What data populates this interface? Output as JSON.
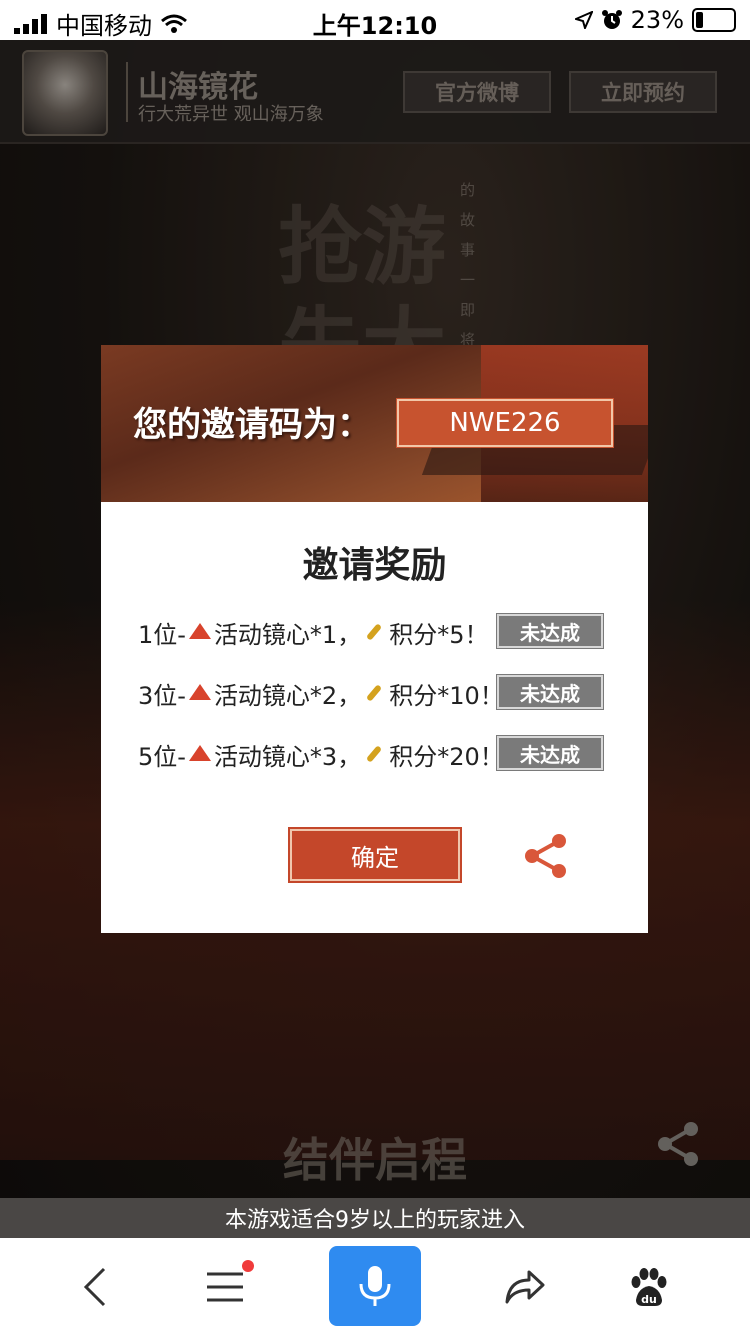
{
  "status_bar": {
    "carrier": "中国移动",
    "time": "上午12:10",
    "battery": "23%"
  },
  "header": {
    "title": "山海镜花",
    "subtitle": "行大荒异世 观山海万象",
    "weibo_button": "官方微博",
    "reserve_button": "立即预约"
  },
  "background": {
    "deco_text_1": "抢游",
    "deco_text_2": "先大",
    "vertical_text": "的故事一即将",
    "bottom_title": "结伴启程"
  },
  "modal": {
    "invite_label": "您的邀请码为：",
    "invite_code": "NWE226",
    "title": "邀请奖励",
    "rewards": [
      {
        "tier": "1位-",
        "item": "活动镜心*1，",
        "points": "积分*5！",
        "status": "未达成"
      },
      {
        "tier": "3位-",
        "item": "活动镜心*2，",
        "points": "积分*10！",
        "status": "未达成"
      },
      {
        "tier": "5位-",
        "item": "活动镜心*3，",
        "points": "积分*20！",
        "status": "未达成"
      }
    ],
    "confirm_button": "确定"
  },
  "age_notice": "本游戏适合9岁以上的玩家进入",
  "colors": {
    "accent": "#c4472a",
    "mic_blue": "#2f8bf0",
    "badge_gray": "#7a7a7a"
  },
  "icons": {
    "toolbar": [
      "back-icon",
      "menu-icon",
      "mic-icon",
      "share-forward-icon",
      "baidu-paw-icon"
    ]
  }
}
